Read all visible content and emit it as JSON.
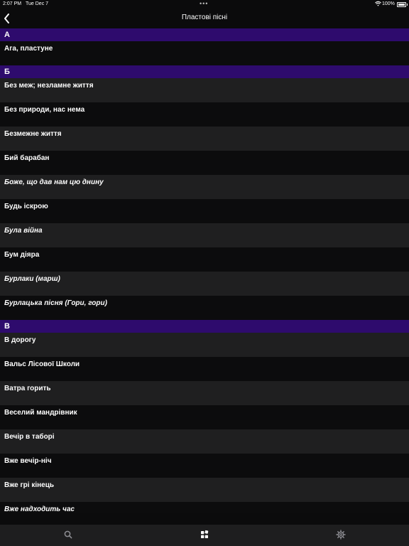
{
  "status_bar": {
    "time": "2:07 PM",
    "date": "Tue Dec 7",
    "battery": "100%"
  },
  "nav": {
    "title": "Пластові пісні",
    "back_icon": "chevron-left-icon"
  },
  "sections": [
    {
      "letter": "А",
      "items": [
        {
          "title": "Ага, пластуне",
          "italic": false
        }
      ]
    },
    {
      "letter": "Б",
      "items": [
        {
          "title": "Без меж; незламне життя",
          "italic": false
        },
        {
          "title": "Без природи, нас нема",
          "italic": false
        },
        {
          "title": "Безмежне життя",
          "italic": false
        },
        {
          "title": "Бий барабан",
          "italic": false
        },
        {
          "title": "Боже, що дав нам цю днину",
          "italic": true
        },
        {
          "title": "Будь іскрою",
          "italic": false
        },
        {
          "title": "Була війна",
          "italic": true
        },
        {
          "title": "Бум діяра",
          "italic": false
        },
        {
          "title": "Бурлаки (марш)",
          "italic": true
        },
        {
          "title": "Бурлацька пісня (Гори, гори)",
          "italic": true
        }
      ]
    },
    {
      "letter": "В",
      "items": [
        {
          "title": "В дорогу",
          "italic": false
        },
        {
          "title": "Вальс Лісової Школи",
          "italic": false
        },
        {
          "title": "Ватра горить",
          "italic": false
        },
        {
          "title": "Веселий мандрівник",
          "italic": false
        },
        {
          "title": "Вечір в таборі",
          "italic": false
        },
        {
          "title": "Вже вечір-ніч",
          "italic": false
        },
        {
          "title": "Вже грі кінець",
          "italic": false
        },
        {
          "title": "Вже надходить час",
          "italic": true
        }
      ]
    }
  ],
  "tab_bar": {
    "tabs": [
      {
        "icon": "search-icon"
      },
      {
        "icon": "grid-icon"
      },
      {
        "icon": "gear-icon"
      }
    ]
  }
}
